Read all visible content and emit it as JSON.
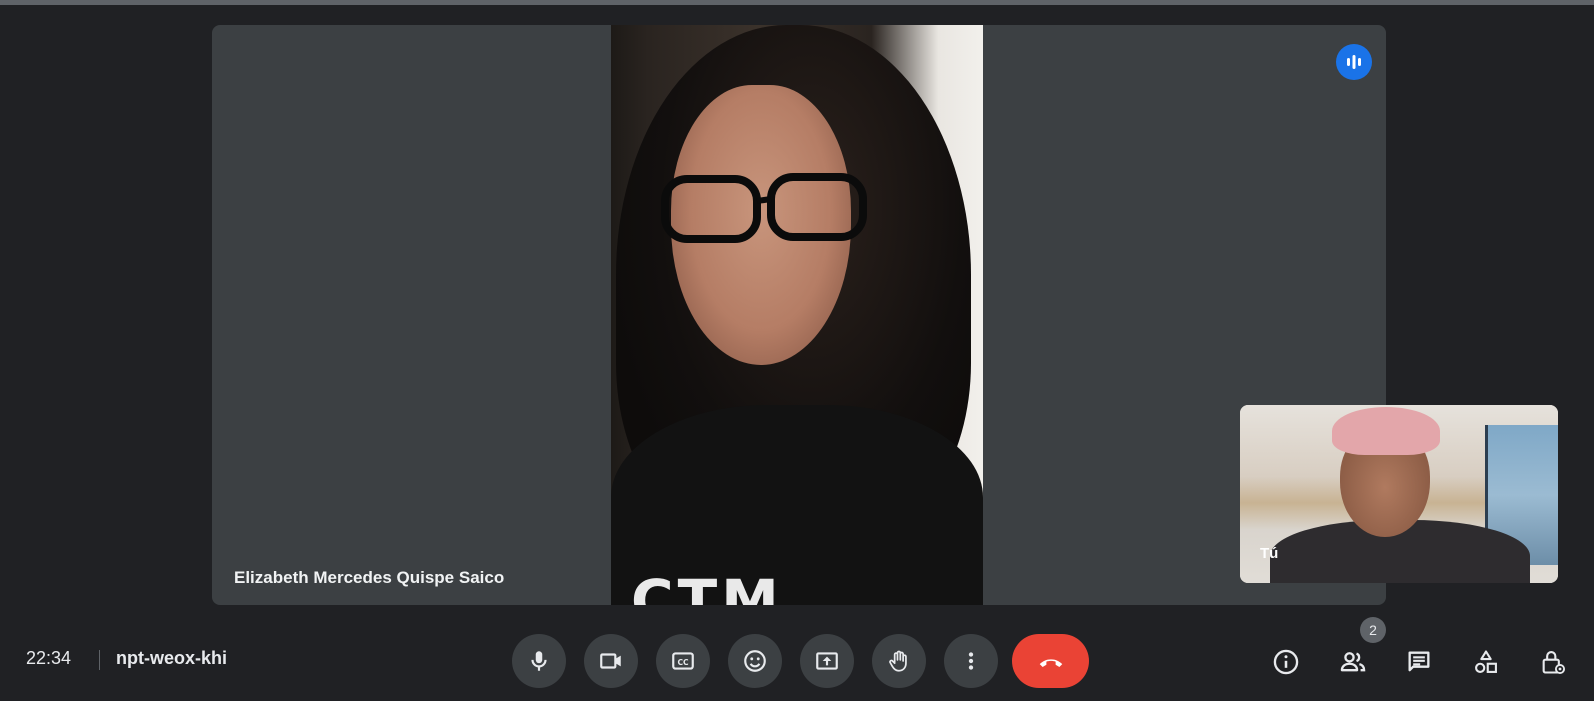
{
  "meeting": {
    "time": "22:34",
    "code": "npt-weox-khi"
  },
  "main_participant": {
    "name": "Elizabeth Mercedes Quispe Saico",
    "shirt_text": "CTM"
  },
  "self_view": {
    "label": "Tú"
  },
  "people": {
    "count": "2"
  },
  "controls": {
    "icons": [
      "microphone-icon",
      "camera-icon",
      "captions-icon",
      "emoji-icon",
      "present-screen-icon",
      "raise-hand-icon",
      "more-options-icon",
      "end-call-icon"
    ],
    "right_icons": [
      "info-icon",
      "people-icon",
      "chat-icon",
      "activities-icon",
      "host-controls-icon"
    ]
  },
  "colors": {
    "background": "#202124",
    "tile": "#3c4043",
    "leave": "#ea4335",
    "speaking": "#1a73e8"
  }
}
